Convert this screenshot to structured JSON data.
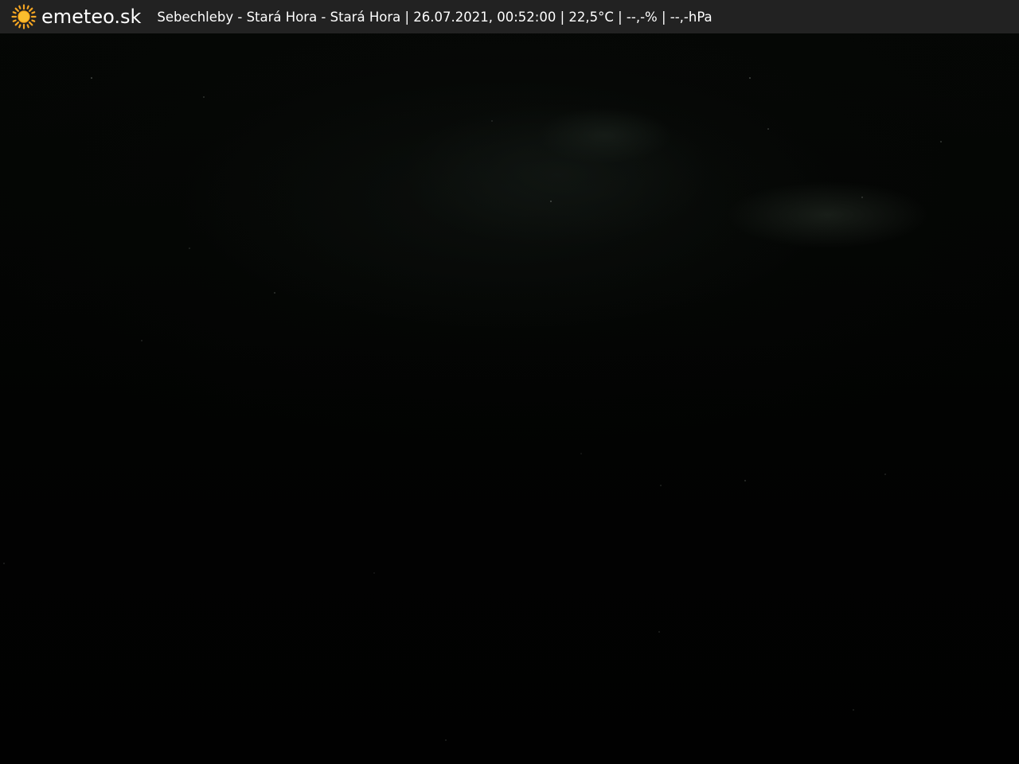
{
  "header": {
    "brand": "emeteo.sk",
    "caption": "Sebechleby - Stará Hora - Stará Hora | 26.07.2021, 00:52:00 | 22,5°C | --,-% | --,-hPa",
    "logo_icon": "sun-icon",
    "logo_color": "#f5a623",
    "bar_color": "#222222"
  },
  "image": {
    "scene": "night-sky-webcam",
    "background_color": "#000000"
  }
}
